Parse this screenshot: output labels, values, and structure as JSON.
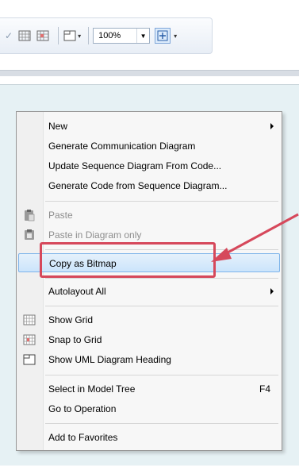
{
  "toolbar": {
    "zoom_value": "100%"
  },
  "menu": {
    "items": [
      {
        "label": "New",
        "submenu": true
      },
      {
        "label": "Generate Communication Diagram"
      },
      {
        "label": "Update Sequence Diagram From Code..."
      },
      {
        "label": "Generate Code from Sequence Diagram..."
      },
      {
        "label": "Paste",
        "disabled": true
      },
      {
        "label": "Paste in Diagram only",
        "disabled": true
      },
      {
        "label": "Copy as Bitmap",
        "highlighted": true
      },
      {
        "label": "Autolayout All",
        "submenu": true
      },
      {
        "label": "Show Grid"
      },
      {
        "label": "Snap to Grid"
      },
      {
        "label": "Show UML Diagram Heading"
      },
      {
        "label": "Select in Model Tree",
        "shortcut": "F4"
      },
      {
        "label": "Go to Operation"
      },
      {
        "label": "Add to Favorites"
      }
    ]
  },
  "colors": {
    "annotation": "#d6485b",
    "highlight_border": "#7eb4ea",
    "highlight_fill": "#cbe4fb"
  }
}
